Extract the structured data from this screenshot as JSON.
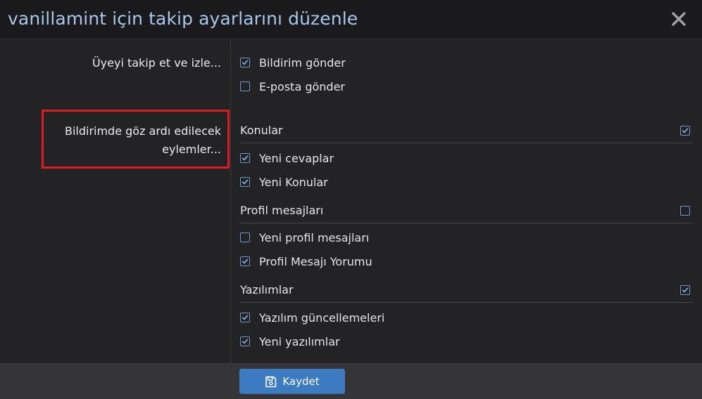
{
  "dialog": {
    "title": "vanillamint için takip ayarlarını düzenle",
    "close_icon": "close-icon"
  },
  "follow": {
    "label": "Üyeyi takip et ve izle...",
    "options": [
      {
        "label": "Bildirim gönder",
        "checked": true
      },
      {
        "label": "E-posta gönder",
        "checked": false
      }
    ]
  },
  "ignore": {
    "label_line1": "Bildirimde göz ardı edilecek",
    "label_line2": "eylemler...",
    "highlight_color": "#e11b22",
    "groups": [
      {
        "title": "Konular",
        "checked": true,
        "items": [
          {
            "label": "Yeni cevaplar",
            "checked": true
          },
          {
            "label": "Yeni Konular",
            "checked": true
          }
        ]
      },
      {
        "title": "Profil mesajları",
        "checked": false,
        "items": [
          {
            "label": "Yeni profil mesajları",
            "checked": false
          },
          {
            "label": "Profil Mesajı Yorumu",
            "checked": true
          }
        ]
      },
      {
        "title": "Yazılımlar",
        "checked": true,
        "items": [
          {
            "label": "Yazılım güncellemeleri",
            "checked": true
          },
          {
            "label": "Yeni yazılımlar",
            "checked": true
          }
        ]
      }
    ]
  },
  "footer": {
    "save_label": "Kaydet",
    "save_icon": "save-icon"
  },
  "colors": {
    "accent": "#3c7ac2",
    "checkbox": "#6a9ad2",
    "title": "#a8c7ea"
  }
}
